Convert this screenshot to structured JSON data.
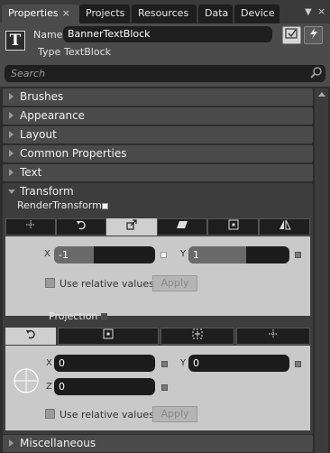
{
  "tabs": [
    {
      "label": "Properties",
      "active": true,
      "close": "×"
    },
    {
      "label": "Projects"
    },
    {
      "label": "Resources"
    },
    {
      "label": "Data"
    },
    {
      "label": "Device"
    }
  ],
  "window_controls": {
    "pin": "▼",
    "close": "×"
  },
  "header": {
    "icon_glyph": "T",
    "name_label": "Name",
    "name_value": "BannerTextBlock",
    "type_label": "Type",
    "type_value": "TextBlock"
  },
  "search": {
    "placeholder": "Search"
  },
  "sections": {
    "brushes": "Brushes",
    "appearance": "Appearance",
    "layout": "Layout",
    "common": "Common Properties",
    "text": "Text",
    "transform": "Transform",
    "misc": "Miscellaneous"
  },
  "transform": {
    "render_label": "RenderTransform",
    "render_tabs": [
      "translate",
      "rotate",
      "scale",
      "skew",
      "center-point",
      "flip"
    ],
    "active_render_tab": "scale",
    "x_label": "X",
    "x_value": "-1",
    "y_label": "Y",
    "y_value": "1",
    "use_relative": "Use relative values",
    "apply": "Apply",
    "projection_label": "Projection",
    "proj_tabs": [
      "rotation",
      "center-of-rotation",
      "global-offset",
      "local-offset"
    ],
    "active_proj_tab": "rotation",
    "px_label": "X",
    "px_value": "0",
    "py_label": "Y",
    "py_value": "0",
    "pz_label": "Z",
    "pz_value": "0",
    "use_relative_2": "Use relative values",
    "apply_2": "Apply"
  },
  "colors": {
    "panel": "#4b4b4b",
    "dark": "#1e1e1e",
    "light_panel": "#c9c9c9"
  }
}
